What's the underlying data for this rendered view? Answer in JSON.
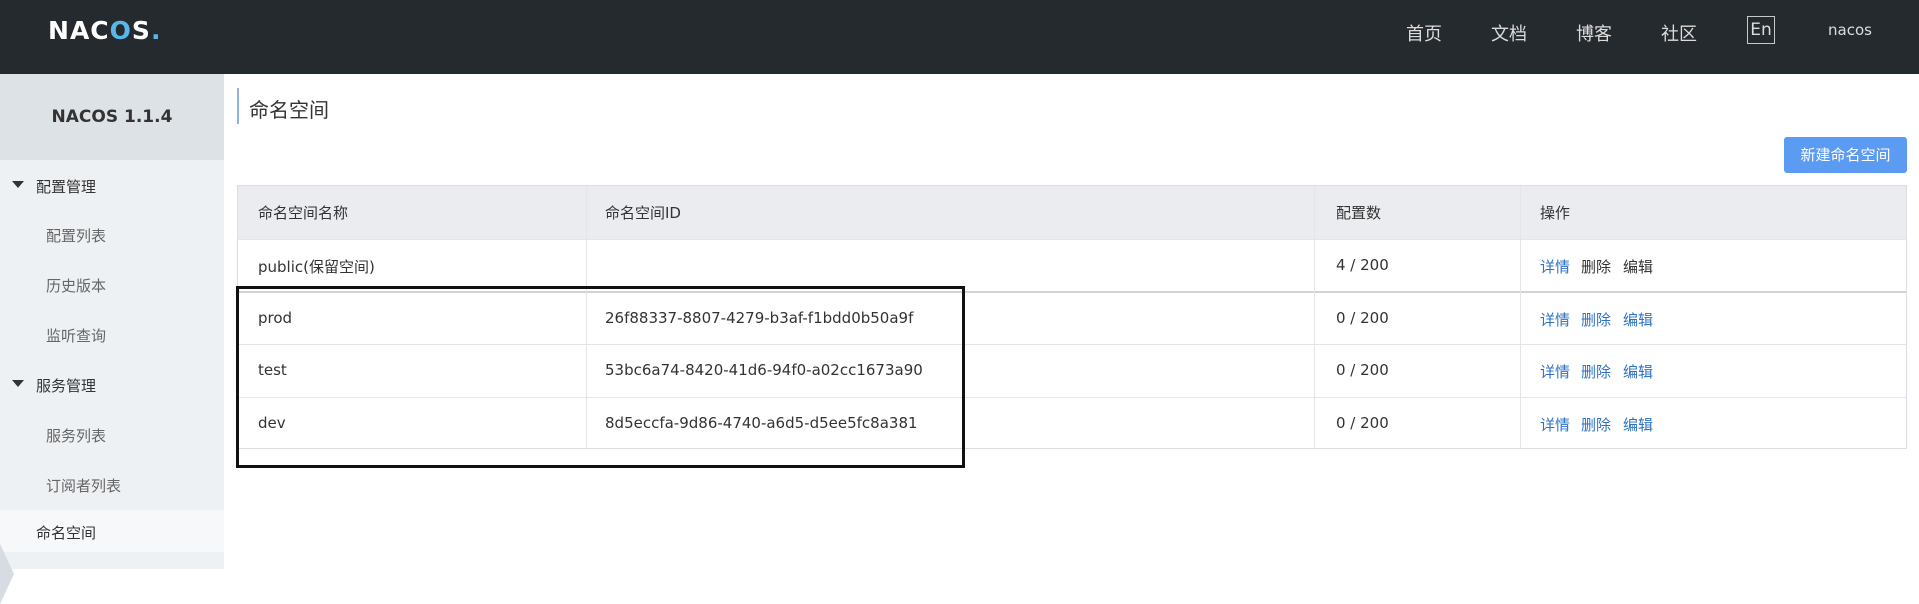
{
  "header": {
    "logo": {
      "n": "N",
      "a": "A",
      "c": "C",
      "o": "O",
      "s": "S",
      "dot": "."
    },
    "nav": [
      "首页",
      "文档",
      "博客",
      "社区"
    ],
    "lang": "En",
    "user": "nacos"
  },
  "sidebar": {
    "title": "NACOS 1.1.4",
    "groups": [
      {
        "label": "配置管理",
        "items": [
          "配置列表",
          "历史版本",
          "监听查询"
        ]
      },
      {
        "label": "服务管理",
        "items": [
          "服务列表",
          "订阅者列表"
        ]
      }
    ],
    "active": "命名空间"
  },
  "main": {
    "title": "命名空间",
    "new_button": "新建命名空间",
    "columns": [
      "命名空间名称",
      "命名空间ID",
      "配置数",
      "操作"
    ],
    "rows": [
      {
        "name": "public(保留空间)",
        "id": "",
        "count": "4 / 200",
        "actions": [
          "详情",
          "删除",
          "编辑"
        ]
      },
      {
        "name": "prod",
        "id": "26f88337-8807-4279-b3af-f1bdd0b50a9f",
        "count": "0 / 200",
        "actions": [
          "详情",
          "删除",
          "编辑"
        ]
      },
      {
        "name": "test",
        "id": "53bc6a74-8420-41d6-94f0-a02cc1673a90",
        "count": "0 / 200",
        "actions": [
          "详情",
          "删除",
          "编辑"
        ]
      },
      {
        "name": "dev",
        "id": "8d5eccfa-9d86-4740-a6d5-d5ee5fc8a381",
        "count": "0 / 200",
        "actions": [
          "详情",
          "删除",
          "编辑"
        ]
      }
    ]
  },
  "colors": {
    "header_bg": "#252a2f",
    "accent": "#5b9bf2",
    "link": "#2f72c4"
  }
}
